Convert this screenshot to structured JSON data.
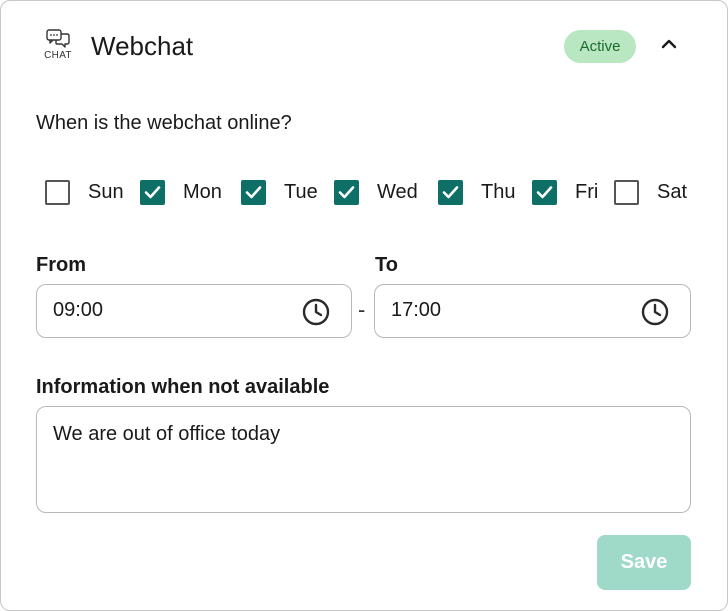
{
  "header": {
    "icon": "chat-bubbles-icon",
    "icon_label": "CHAT",
    "title": "Webchat",
    "status_badge": "Active",
    "collapse_icon": "chevron-up-icon"
  },
  "schedule": {
    "question": "When is the webchat online?",
    "days": [
      {
        "label": "Sun",
        "checked": false
      },
      {
        "label": "Mon",
        "checked": true
      },
      {
        "label": "Tue",
        "checked": true
      },
      {
        "label": "Wed",
        "checked": true
      },
      {
        "label": "Thu",
        "checked": true
      },
      {
        "label": "Fri",
        "checked": true
      },
      {
        "label": "Sat",
        "checked": false
      }
    ],
    "from_label": "From",
    "from_value": "09:00",
    "separator": "-",
    "to_label": "To",
    "to_value": "17:00",
    "time_icon": "clock-icon"
  },
  "unavailable": {
    "label": "Information when not available",
    "value": "We are out of office today"
  },
  "actions": {
    "save_label": "Save",
    "save_enabled": false
  },
  "colors": {
    "accent": "#0e6f66",
    "badge_bg": "#b8e7c1",
    "badge_text": "#1d6a2f",
    "save_disabled_bg": "#9fd9c7"
  }
}
